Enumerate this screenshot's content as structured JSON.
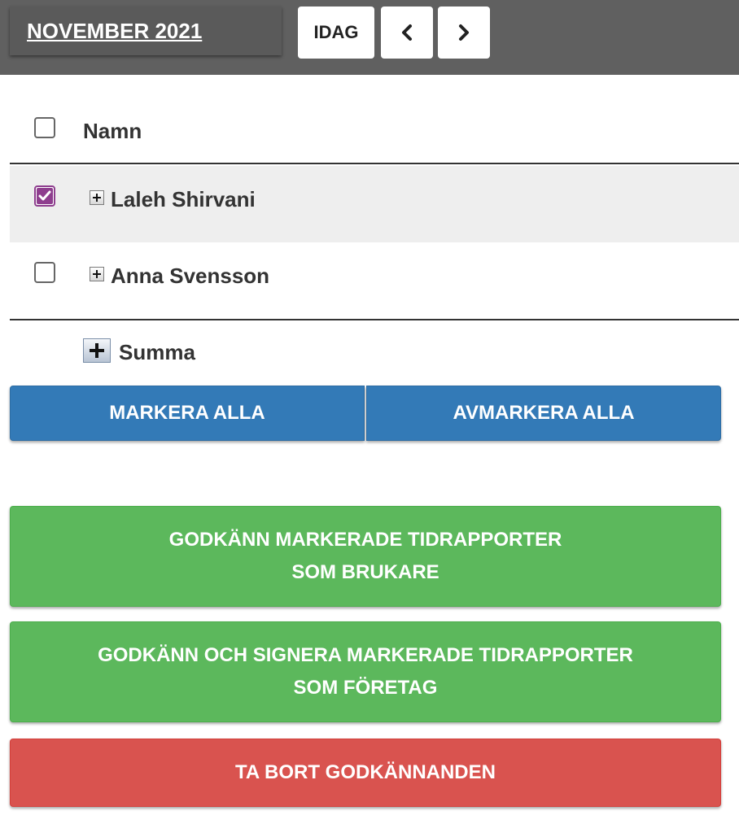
{
  "header": {
    "month_label": "NOVEMBER 2021",
    "today_label": "IDAG",
    "prev_icon": "chevron-left-icon",
    "next_icon": "chevron-right-icon"
  },
  "table": {
    "column_name": "Namn",
    "rows": [
      {
        "name": "Laleh Shirvani",
        "checked": true
      },
      {
        "name": "Anna Svensson",
        "checked": false
      }
    ],
    "sum_label": "Summa"
  },
  "actions": {
    "mark_all": "MARKERA ALLA",
    "unmark_all": "AVMARKERA ALLA",
    "approve_user_line1": "GODKÄNN MARKERADE TIDRAPPORTER",
    "approve_user_line2": "SOM BRUKARE",
    "approve_sign_line1": "GODKÄNN OCH SIGNERA MARKERADE TIDRAPPORTER",
    "approve_sign_line2": "SOM FÖRETAG",
    "remove": "TA BORT GODKÄNNANDEN"
  },
  "colors": {
    "topbar": "#606060",
    "blue": "#337ab7",
    "green": "#5cb85c",
    "red": "#d9534f",
    "check_accent": "#8e3e8e"
  }
}
